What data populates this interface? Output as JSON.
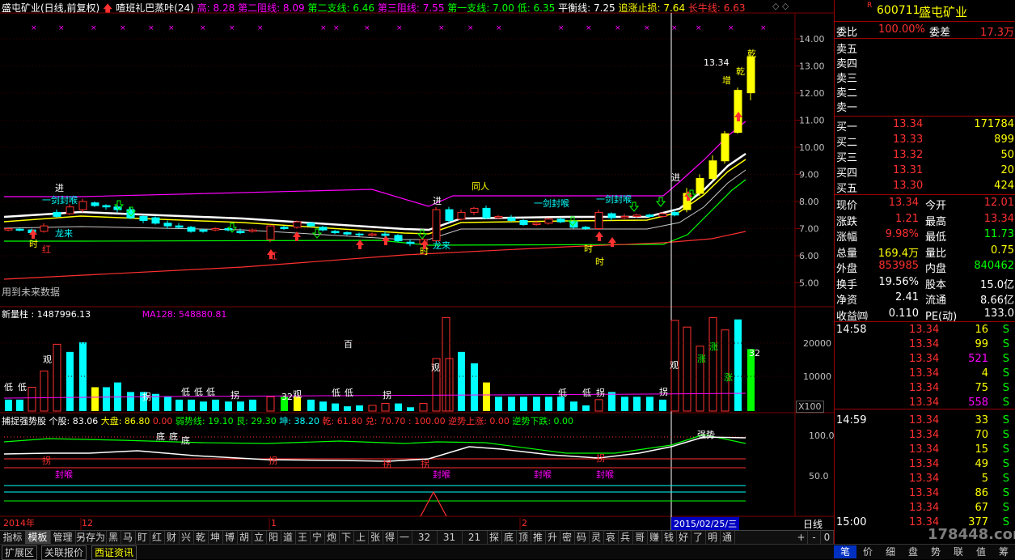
{
  "main": {
    "title": "盛屯矿业(日线,前复权)",
    "indicator_name": "喳班礼巴蒸咔(24)",
    "legend": [
      {
        "label": "高: 8.28",
        "color": "#ff00ff"
      },
      {
        "label": "第二阻线: 8.09",
        "color": "#ff00ff"
      },
      {
        "label": "第二支线: 6.46",
        "color": "#00ff00"
      },
      {
        "label": "第三阻线: 7.55",
        "color": "#ff00ff"
      },
      {
        "label": "第一支线: 7.00",
        "color": "#00ff00"
      },
      {
        "label": "低: 6.35",
        "color": "#00ff00"
      },
      {
        "label": "平衡线: 7.25",
        "color": "#ffffff"
      },
      {
        "label": "追涨止损: 7.64",
        "color": "#ffff00"
      },
      {
        "label": "长牛线: 6.63",
        "color": "#ff3030"
      }
    ],
    "future_note": "用到未来数据",
    "y_ticks": [
      "14.00",
      "13.00",
      "12.00",
      "11.00",
      "10.00",
      "9.00",
      "8.00",
      "7.00",
      "6.00",
      "5.00"
    ],
    "annotations": {
      "high_price": "13.34",
      "jin1": "进",
      "jin2": "进",
      "jin3": "进",
      "yijianfenghou1": "一剑封喉",
      "yijianfenghou2": "一剑封喉",
      "yijianfenghou3": "一剑封喉",
      "longlai1": "龙来",
      "longlai2": "龙来",
      "tongren": "同人",
      "zeng": "增",
      "qian": "乾",
      "hong": "红",
      "shi": "时"
    }
  },
  "volume": {
    "title": "新量柱 : 1487996.13",
    "ma": "MA128: 548880.81",
    "y_ticks": [
      "20000",
      "10000"
    ],
    "unit": "X100",
    "annotations": {
      "di": "低",
      "bai": "百",
      "guan": "观",
      "guai": "拐",
      "n32": "32",
      "zhang": "涨"
    }
  },
  "indicator": {
    "name": "捕捉强势股",
    "values": [
      {
        "label": "个股: 83.06",
        "color": "#ffffff"
      },
      {
        "label": "大盘: 86.80",
        "color": "#ffff00"
      },
      {
        "label": "0.00",
        "color": "#ff3030"
      },
      {
        "label": "弱势线: 19.10",
        "color": "#00ff00"
      },
      {
        "label": "艮: 29.30",
        "color": "#00ff00"
      },
      {
        "label": "坤: 38.20",
        "color": "#00ffff"
      },
      {
        "label": "乾: 61.80",
        "color": "#ff3030"
      },
      {
        "label": "兑: 70.70",
        "color": "#ff3030"
      },
      {
        "label": ": 100.00",
        "color": "#ff3030"
      },
      {
        "label": "逆势上涨: 0.00",
        "color": "#ff3030"
      },
      {
        "label": "逆势下跌: 0.00",
        "color": "#00ff00"
      }
    ],
    "y_ticks": [
      "100.0",
      "50.0"
    ],
    "annotations": {
      "qiangshi": "强势",
      "di": "底",
      "fenghou": "封喉",
      "guai": "拐"
    }
  },
  "time_axis": {
    "labels": [
      "2014年",
      "12",
      "1",
      "2"
    ],
    "cursor_date": "2015/02/25/三",
    "period": "日线"
  },
  "quote": {
    "code": "600711",
    "name": "盛屯矿业",
    "weibi_label": "委比",
    "weibi": "100.00%",
    "weicha_label": "委差",
    "weicha": "17.3万",
    "sells": [
      "卖五",
      "卖四",
      "卖三",
      "卖二",
      "卖一"
    ],
    "buys": [
      {
        "label": "买一",
        "price": "13.34",
        "vol": "171784"
      },
      {
        "label": "买二",
        "price": "13.33",
        "vol": "899"
      },
      {
        "label": "买三",
        "price": "13.32",
        "vol": "50"
      },
      {
        "label": "买四",
        "price": "13.31",
        "vol": "20"
      },
      {
        "label": "买五",
        "price": "13.30",
        "vol": "424"
      }
    ],
    "stats": [
      {
        "l1": "现价",
        "v1": "13.34",
        "l2": "今开",
        "v2": "12.01",
        "c1": "#ff3030",
        "c2": "#ff3030"
      },
      {
        "l1": "涨跌",
        "v1": "1.21",
        "l2": "最高",
        "v2": "13.34",
        "c1": "#ff3030",
        "c2": "#ff3030"
      },
      {
        "l1": "涨幅",
        "v1": "9.98%",
        "l2": "最低",
        "v2": "11.73",
        "c1": "#ff3030",
        "c2": "#00ff00"
      },
      {
        "l1": "总量",
        "v1": "169.4万",
        "l2": "量比",
        "v2": "0.75",
        "c1": "#ffff00",
        "c2": "#ffff00"
      },
      {
        "l1": "外盘",
        "v1": "853985",
        "l2": "内盘",
        "v2": "840462",
        "c1": "#ff3030",
        "c2": "#00ff00"
      },
      {
        "l1": "换手",
        "v1": "19.56%",
        "l2": "股本",
        "v2": "15.0亿",
        "c1": "#ffffff",
        "c2": "#ffffff"
      },
      {
        "l1": "净资",
        "v1": "2.41",
        "l2": "流通",
        "v2": "8.66亿",
        "c1": "#ffffff",
        "c2": "#ffffff"
      },
      {
        "l1": "收益㈣",
        "v1": "0.110",
        "l2": "PE(动)",
        "v2": "133.0",
        "c1": "#ffffff",
        "c2": "#ffffff"
      }
    ],
    "ticks": [
      {
        "time": "14:58",
        "price": "13.34",
        "vol": "16",
        "type": "S",
        "vc": "#ffff00"
      },
      {
        "time": "",
        "price": "13.34",
        "vol": "99",
        "type": "S",
        "vc": "#ffff00"
      },
      {
        "time": "",
        "price": "13.34",
        "vol": "521",
        "type": "S",
        "vc": "#ff00ff"
      },
      {
        "time": "",
        "price": "13.34",
        "vol": "4",
        "type": "S",
        "vc": "#ffff00"
      },
      {
        "time": "",
        "price": "13.34",
        "vol": "75",
        "type": "S",
        "vc": "#ffff00"
      },
      {
        "time": "",
        "price": "13.34",
        "vol": "558",
        "type": "S",
        "vc": "#ff00ff"
      },
      {
        "time": "14:59",
        "price": "13.34",
        "vol": "33",
        "type": "S",
        "vc": "#ffff00"
      },
      {
        "time": "",
        "price": "13.34",
        "vol": "70",
        "type": "S",
        "vc": "#ffff00"
      },
      {
        "time": "",
        "price": "13.34",
        "vol": "15",
        "type": "S",
        "vc": "#ffff00"
      },
      {
        "time": "",
        "price": "13.34",
        "vol": "49",
        "type": "S",
        "vc": "#ffff00"
      },
      {
        "time": "",
        "price": "13.34",
        "vol": "5",
        "type": "S",
        "vc": "#ffff00"
      },
      {
        "time": "",
        "price": "13.34",
        "vol": "86",
        "type": "S",
        "vc": "#ffff00"
      },
      {
        "time": "",
        "price": "13.34",
        "vol": "67",
        "type": "S",
        "vc": "#ffff00"
      },
      {
        "time": "15:00",
        "price": "13.34",
        "vol": "377",
        "type": "S",
        "vc": "#ffff00"
      }
    ],
    "tabs": [
      "笔",
      "价",
      "细",
      "盘",
      "势",
      "联",
      "值",
      "筹"
    ]
  },
  "bottom_tabs": [
    "指标",
    "模板",
    "管理",
    "另存为",
    "黑",
    "马",
    "盯",
    "红",
    "财",
    "兴",
    "乾",
    "坤",
    "博",
    "胡",
    "立",
    "阳",
    "道",
    "王",
    "宁",
    "炮",
    "下",
    "上",
    "张",
    "得",
    "一",
    "32",
    "31",
    "21",
    "探",
    "底",
    "顶",
    "推",
    "升",
    "密",
    "码",
    "灵",
    "哀",
    "兵",
    "哥",
    "赚",
    "钱",
    "好",
    "了",
    "明",
    "通"
  ],
  "zoom_buttons": [
    "+",
    "-",
    "0"
  ],
  "status_tabs": [
    "扩展区",
    "关联报价",
    "西证资讯"
  ],
  "watermark": "178448.com",
  "colors": {
    "bg": "#000000",
    "grid": "#7a0000",
    "up": "#ff3030",
    "down": "#00ffff",
    "ma": "#ffffff"
  }
}
